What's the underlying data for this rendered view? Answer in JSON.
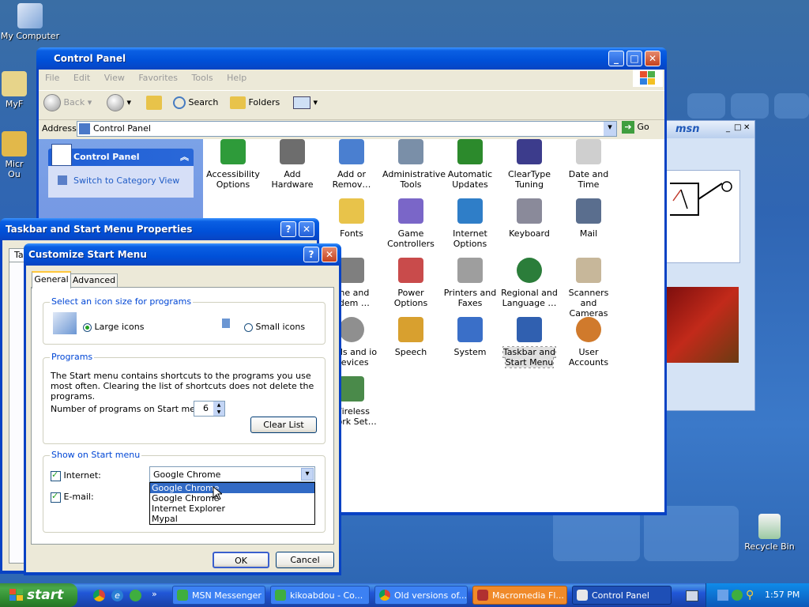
{
  "desktop": {
    "icons": [
      {
        "label": "My Computer",
        "icon": "my-computer-icon"
      },
      {
        "label": "Recycle Bin",
        "icon": "recycle-bin-icon"
      }
    ],
    "partial_labels": [
      "MyF",
      "Micr",
      "Ou"
    ]
  },
  "control_panel": {
    "title": "Control Panel",
    "menu": [
      "File",
      "Edit",
      "View",
      "Favorites",
      "Tools",
      "Help"
    ],
    "toolbar": {
      "back": "Back",
      "search": "Search",
      "folders": "Folders"
    },
    "address_label": "Address",
    "address_value": "Control Panel",
    "go": "Go",
    "sidebar": {
      "title": "Control Panel",
      "switch_link": "Switch to Category View"
    },
    "items": [
      {
        "label": "Accessibility Options",
        "icon": "accessibility-icon",
        "color": "#2e9b3a"
      },
      {
        "label": "Add Hardware",
        "icon": "add-hardware-icon",
        "color": "#6d6d6d"
      },
      {
        "label": "Add or Remov…",
        "icon": "add-remove-programs-icon",
        "color": "#4a7fd0"
      },
      {
        "label": "Administrative Tools",
        "icon": "admin-tools-icon",
        "color": "#7a8fa8"
      },
      {
        "label": "Automatic Updates",
        "icon": "windows-update-icon",
        "color": "#2c8a2c"
      },
      {
        "label": "ClearType Tuning",
        "icon": "cleartype-icon",
        "color": "#3c3c8c"
      },
      {
        "label": "Date and Time",
        "icon": "date-time-icon",
        "color": "#cfcfcf"
      },
      {
        "label": "Fonts",
        "icon": "fonts-folder-icon",
        "color": "#e8c34a"
      },
      {
        "label": "Game Controllers",
        "icon": "game-controller-icon",
        "color": "#7a66c8"
      },
      {
        "label": "Internet Options",
        "icon": "internet-options-icon",
        "color": "#2f7ec8"
      },
      {
        "label": "Keyboard",
        "icon": "keyboard-icon",
        "color": "#8a8a9a"
      },
      {
        "label": "Mail",
        "icon": "mail-icon",
        "color": "#5a6e8e"
      },
      {
        "label": "one and odem …",
        "icon": "phone-modem-icon",
        "color": "#7f7f7f"
      },
      {
        "label": "Power Options",
        "icon": "power-options-icon",
        "color": "#c94b4b"
      },
      {
        "label": "Printers and Faxes",
        "icon": "printer-icon",
        "color": "#9e9e9e"
      },
      {
        "label": "Regional and Language …",
        "icon": "globe-icon",
        "color": "#2b7d3a"
      },
      {
        "label": "Scanners and Cameras",
        "icon": "scanner-icon",
        "color": "#c7b79a"
      },
      {
        "label": "unds and io Devices",
        "icon": "sound-icon",
        "color": "#8f8f8f"
      },
      {
        "label": "Speech",
        "icon": "speech-icon",
        "color": "#d8a02f"
      },
      {
        "label": "System",
        "icon": "system-icon",
        "color": "#3a6fc8"
      },
      {
        "label": "Taskbar and Start Menu",
        "icon": "taskbar-icon",
        "color": "#3060b0"
      },
      {
        "label": "User Accounts",
        "icon": "user-accounts-icon",
        "color": "#d07a2c"
      },
      {
        "label": "Wireless twork Set…",
        "icon": "wireless-icon",
        "color": "#4a8a4a"
      }
    ]
  },
  "taskbar_props": {
    "title": "Taskbar and Start Menu Properties",
    "tab": "Ta"
  },
  "customize": {
    "title": "Customize Start Menu",
    "tabs": [
      "General",
      "Advanced"
    ],
    "icon_size": {
      "legend": "Select an icon size for programs",
      "large": "Large icons",
      "small": "Small icons"
    },
    "programs": {
      "legend": "Programs",
      "text": "The Start menu contains shortcuts to the programs you use most often. Clearing the list of shortcuts does not delete the programs.",
      "count_label": "Number of programs on Start menu:",
      "count_value": "6",
      "clear": "Clear List"
    },
    "show": {
      "legend": "Show on Start menu",
      "internet": "Internet:",
      "email": "E-mail:",
      "selected": "Google Chrome",
      "options": [
        "Google Chrome",
        "Google Chrome",
        "Internet Explorer",
        "Mypal"
      ]
    },
    "ok": "OK",
    "cancel": "Cancel"
  },
  "msn": {
    "logo": "msn"
  },
  "taskbar": {
    "start": "start",
    "tasks": [
      {
        "label": "MSN Messenger"
      },
      {
        "label": "kikoabdou - Co..."
      },
      {
        "label": "Old versions of..."
      },
      {
        "label": "Macromedia Fl..."
      },
      {
        "label": "Control Panel"
      }
    ],
    "clock": "1:57 PM"
  }
}
